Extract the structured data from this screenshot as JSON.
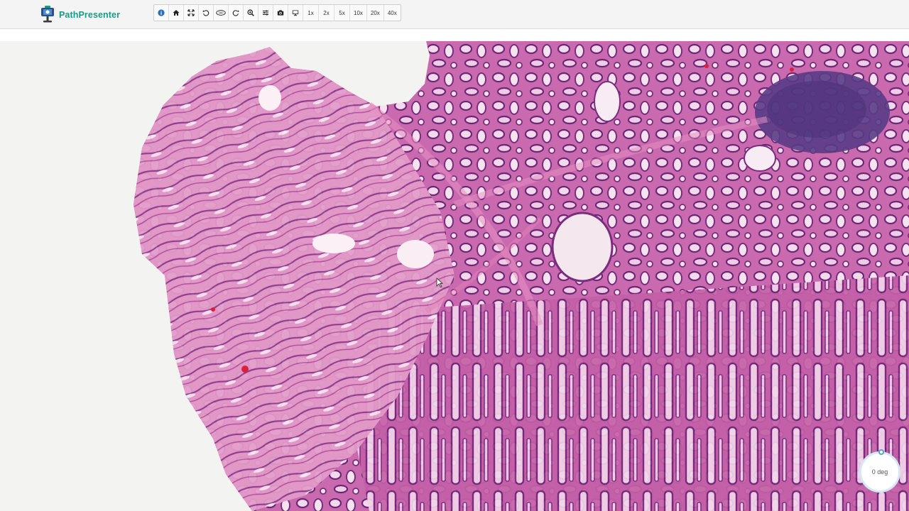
{
  "app": {
    "name": "PathPresenter"
  },
  "toolbar": {
    "buttons": [
      {
        "icon": "info-icon"
      },
      {
        "icon": "home-icon"
      },
      {
        "icon": "fullscreen-icon"
      },
      {
        "icon": "rotate-left-icon"
      },
      {
        "icon": "rotate-360-icon",
        "label": "360"
      },
      {
        "icon": "rotate-right-icon"
      },
      {
        "icon": "zoom-in-icon"
      },
      {
        "icon": "sliders-icon"
      },
      {
        "icon": "camera-icon"
      },
      {
        "icon": "monitor-icon"
      }
    ],
    "zoom_levels": [
      "1x",
      "2x",
      "5x",
      "10x",
      "20x",
      "40x"
    ]
  },
  "rotation": {
    "label": "0 deg"
  },
  "colors": {
    "brand": "#1a9a86",
    "tissue_light": "#e59ac8",
    "tissue_mid": "#c45fa6",
    "tissue_dark": "#7a2c7e",
    "lymphoid": "#5a3c86"
  }
}
